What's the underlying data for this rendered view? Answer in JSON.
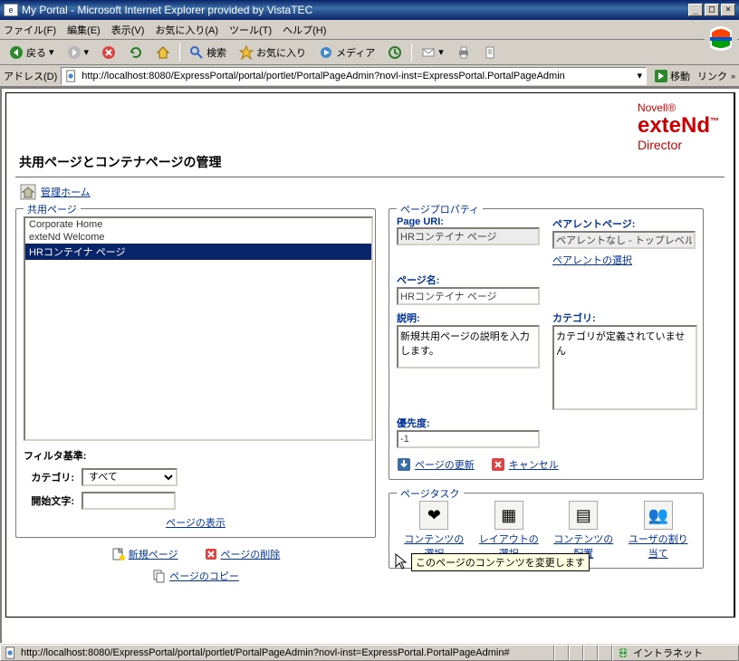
{
  "titlebar": {
    "text": "My Portal - Microsoft Internet Explorer provided by VistaTEC"
  },
  "menubar": [
    "ファイル(F)",
    "編集(E)",
    "表示(V)",
    "お気に入り(A)",
    "ツール(T)",
    "ヘルプ(H)"
  ],
  "toolbar": {
    "back": "戻る",
    "search": "検索",
    "favorites": "お気に入り",
    "media": "メディア"
  },
  "address": {
    "label": "アドレス(D)",
    "url": "http://localhost:8080/ExpressPortal/portal/portlet/PortalPageAdmin?novl-inst=ExpressPortal.PortalPageAdmin",
    "go": "移動",
    "links": "リンク"
  },
  "brand": {
    "line1": "Novell®",
    "line2": "exteNd",
    "tm": "™",
    "line3": "Director"
  },
  "page": {
    "title": "共用ページとコンテナページの管理",
    "admin_home": "管理ホーム"
  },
  "shared_pages": {
    "legend": "共用ページ",
    "items": [
      "Corporate Home",
      "exteNd Welcome",
      "HRコンテイナ ページ"
    ],
    "selected_index": 2,
    "filter_legend": "フィルタ基準:",
    "category_label": "カテゴリ:",
    "category_value": "すべて",
    "startchar_label": "開始文字:",
    "startchar_value": "",
    "show_pages": "ページの表示",
    "new_page": "新規ページ",
    "delete_page": "ページの削除",
    "copy_page": "ページのコピー"
  },
  "props": {
    "legend": "ページプロパティ",
    "uri_label": "Page URI:",
    "uri_value": "HRコンテイナ ページ",
    "parent_label": "ペアレントページ:",
    "parent_value": "ペアレントなし - トップレベル",
    "parent_select": "ペアレントの選択",
    "name_label": "ページ名:",
    "name_value": "HRコンテイナ ページ",
    "desc_label": "説明:",
    "desc_value": "新規共用ページの説明を入力します。",
    "cat_label": "カテゴリ:",
    "cat_value": "カテゴリが定義されていません",
    "priority_label": "優先度:",
    "priority_value": "-1",
    "update_page": "ページの更新",
    "cancel": "キャンセル"
  },
  "tasks": {
    "legend": "ページタスク",
    "content_select": "コンテンツの選択",
    "layout_select": "レイアウトの選択",
    "content_layout": "コンテンツの配置",
    "user_assign": "ユーザの割り当て",
    "tooltip": "このページのコンテンツを変更します"
  },
  "statusbar": {
    "url": "http://localhost:8080/ExpressPortal/portal/portlet/PortalPageAdmin?novl-inst=ExpressPortal.PortalPageAdmin#",
    "zone": "イントラネット"
  }
}
